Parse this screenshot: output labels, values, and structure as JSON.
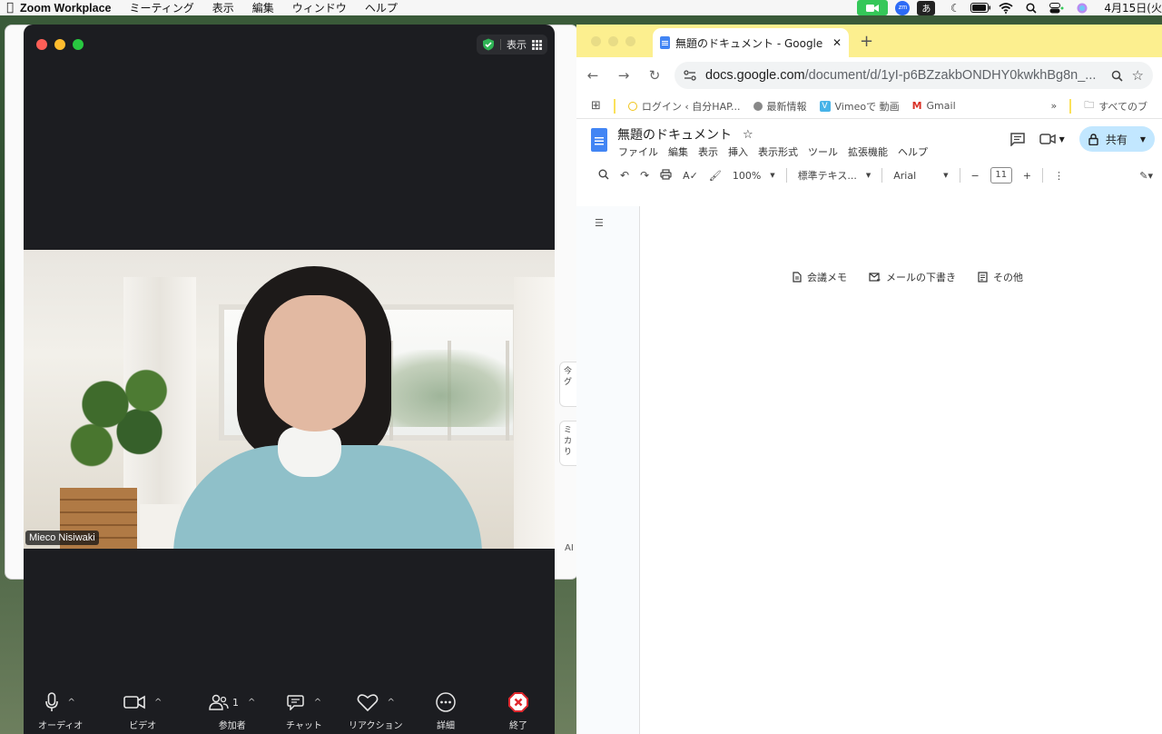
{
  "menubar": {
    "app_name": "Zoom Workplace",
    "menus": [
      "ミーティング",
      "表示",
      "編集",
      "ウィンドウ",
      "ヘルプ"
    ],
    "zm_label": "zm",
    "ime_label": "あ",
    "date": "4月15日(火"
  },
  "background_window": {
    "cards": [
      "今\nグ",
      "ミ\nカ\nり"
    ],
    "ai_label": "AI"
  },
  "zoom": {
    "view_label": "表示",
    "participant_name": "Mieco Nisiwaki",
    "toolbar": {
      "audio": "オーディオ",
      "video": "ビデオ",
      "participants": "参加者",
      "participant_count": "1",
      "chat": "チャット",
      "reaction": "リアクション",
      "more": "詳細",
      "end": "終了"
    }
  },
  "chrome": {
    "tab_title": "無題のドキュメント - Google ド",
    "url_host": "docs.google.com",
    "url_path": "/document/d/1yI-p6BZzakbONDHY0kwkhBg8n_...",
    "bookmarks": [
      "ログイン ‹ 自分HAP...",
      "最新情報",
      "Vimeoで 動画",
      "Gmail"
    ],
    "all_bookmarks": "すべてのブ",
    "accent": "#fcef8f"
  },
  "docs": {
    "title": "無題のドキュメント",
    "menu": [
      "ファイル",
      "編集",
      "表示",
      "挿入",
      "表示形式",
      "ツール",
      "拡張機能",
      "ヘルプ"
    ],
    "share_label": "共有",
    "zoom_level": "100%",
    "style": "標準テキス...",
    "font": "Arial",
    "font_size": "11",
    "chips": [
      "会議メモ",
      "メールの下書き",
      "その他"
    ]
  }
}
